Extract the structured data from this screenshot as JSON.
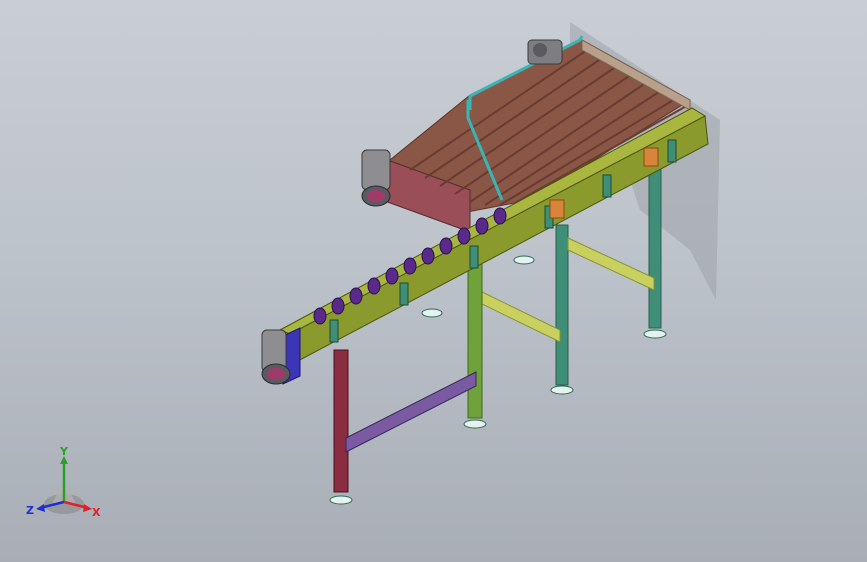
{
  "viewport": {
    "background_top": "#c9ced4",
    "background_bottom": "#a9aeb6"
  },
  "model": {
    "name": "",
    "colors": {
      "frame": "#8a9a2c",
      "frame_dark": "#5f6d18",
      "belt": "#8a5646",
      "belt_slat": "#6a3c30",
      "guide_rail": "#38b6b6",
      "leg_green": "#6fa23a",
      "leg_teal": "#3f8f78",
      "leg_red": "#8a2d40",
      "brace_purple": "#7a5aa0",
      "brace_yellow": "#c8d060",
      "roller": "#5a2a8a",
      "motor": "#8d8d92",
      "end_plate": "#3b35b8",
      "side_box": "#9a4e58",
      "label_orange": "#d8843a",
      "foot": "#e6f2ee"
    }
  },
  "triad": {
    "x_label": "X",
    "y_label": "Y",
    "z_label": "Z",
    "x_color": "#e0202a",
    "y_color": "#2aa02a",
    "z_color": "#2030d0"
  }
}
